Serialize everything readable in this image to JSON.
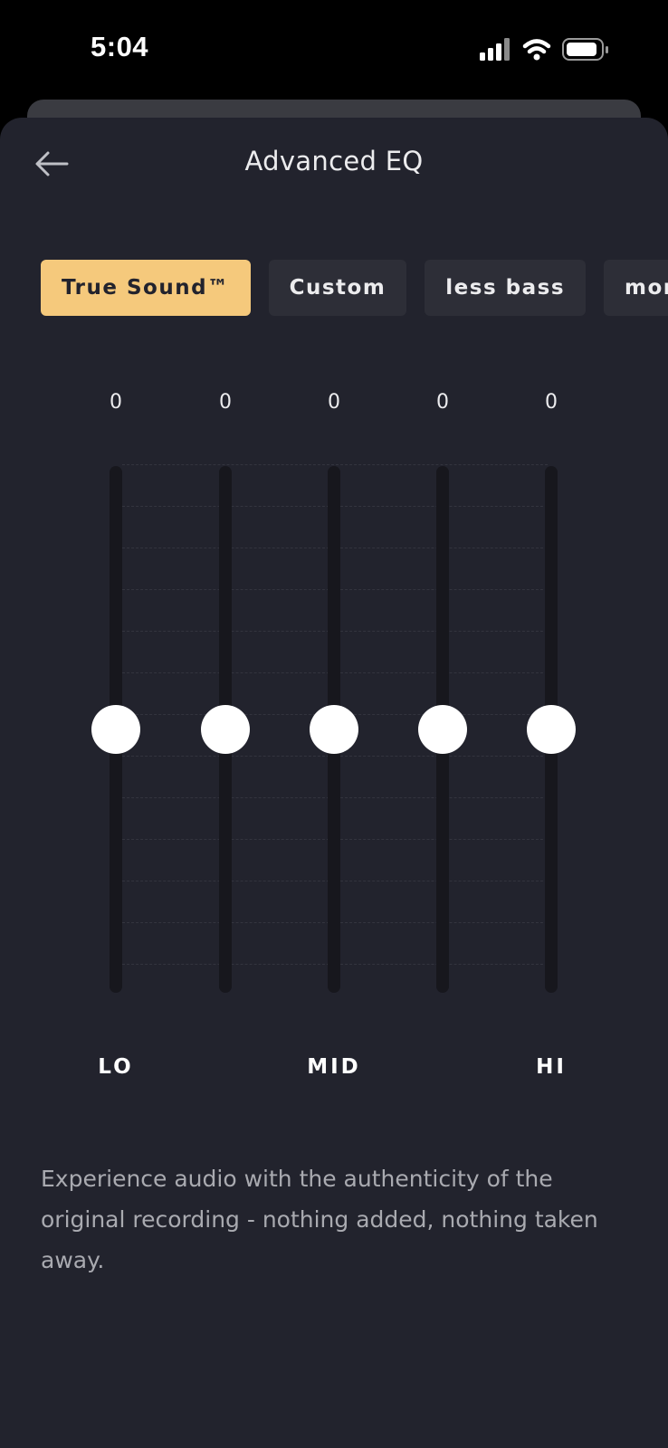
{
  "status_bar": {
    "time": "5:04",
    "icons": [
      "cellular-signal-icon",
      "wifi-icon",
      "battery-icon"
    ]
  },
  "header": {
    "back_icon": "arrow-left-icon",
    "title": "Advanced EQ"
  },
  "presets": [
    {
      "label": "True Sound™",
      "selected": true
    },
    {
      "label": "Custom",
      "selected": false
    },
    {
      "label": "less bass",
      "selected": false
    },
    {
      "label": "more bass",
      "selected": false
    }
  ],
  "eq": {
    "bands": [
      {
        "value": "0",
        "level": 0.5
      },
      {
        "value": "0",
        "level": 0.5
      },
      {
        "value": "0",
        "level": 0.5
      },
      {
        "value": "0",
        "level": 0.5
      },
      {
        "value": "0",
        "level": 0.5
      }
    ],
    "labels": {
      "lo": "LO",
      "mid": "MID",
      "hi": "HI"
    }
  },
  "description": "Experience audio with the authenticity of the original recording - nothing added, nothing taken away.",
  "colors": {
    "sheet_background": "#22232d",
    "accent": "#f5c97c",
    "chip_background": "#2d2e37",
    "track": "#17171d",
    "knob": "#ffffff",
    "description_text": "#a9aab0"
  }
}
